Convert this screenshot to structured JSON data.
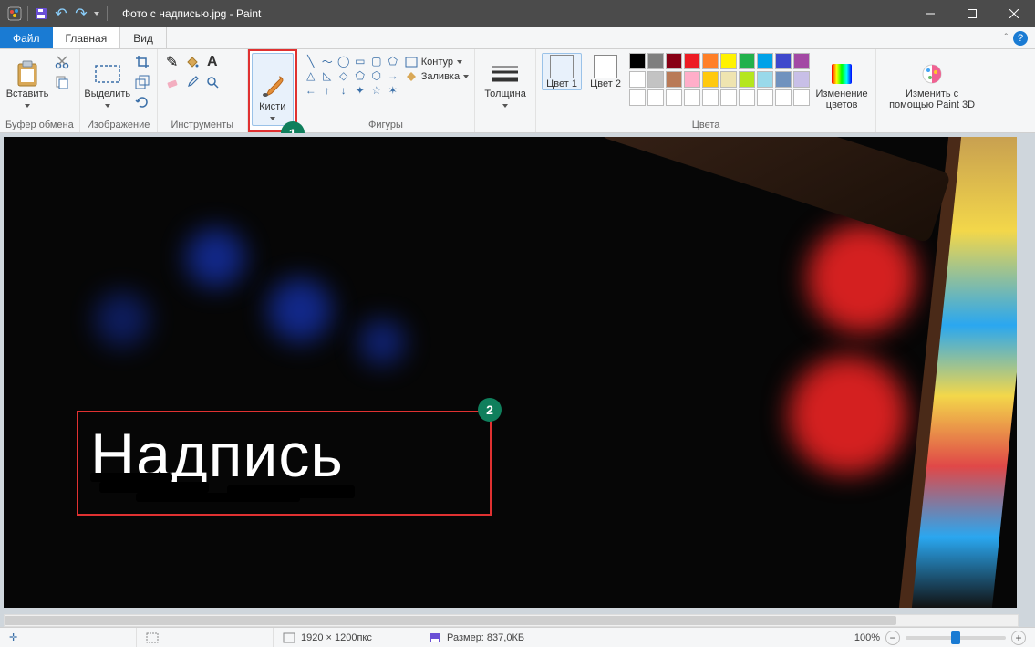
{
  "window": {
    "title": "Фото с надписью.jpg - Paint"
  },
  "tabs": {
    "file": "Файл",
    "home": "Главная",
    "view": "Вид"
  },
  "ribbon": {
    "clipboard": {
      "paste": "Вставить",
      "group": "Буфер обмена"
    },
    "image": {
      "select": "Выделить",
      "group": "Изображение"
    },
    "tools": {
      "group": "Инструменты"
    },
    "brushes": {
      "label": "Кисти"
    },
    "shapes": {
      "outline": "Контур",
      "fill": "Заливка",
      "group": "Фигуры"
    },
    "thickness": {
      "label": "Толщина"
    },
    "colors": {
      "color1": "Цвет 1",
      "color2": "Цвет 2",
      "edit": "Изменение цветов",
      "group": "Цвета",
      "palette": [
        "#000000",
        "#7f7f7f",
        "#880015",
        "#ed1c24",
        "#ff7f27",
        "#fff200",
        "#22b14c",
        "#00a2e8",
        "#3f48cc",
        "#a349a4",
        "#ffffff",
        "#c3c3c3",
        "#b97a57",
        "#ffaec9",
        "#ffc90e",
        "#efe4b0",
        "#b5e61d",
        "#99d9ea",
        "#7092be",
        "#c8bfe7",
        "#ffffff",
        "#ffffff",
        "#ffffff",
        "#ffffff",
        "#ffffff",
        "#ffffff",
        "#ffffff",
        "#ffffff",
        "#ffffff",
        "#ffffff"
      ],
      "c1": "#000000",
      "c2": "#ffffff"
    },
    "paint3d": {
      "label": "Изменить с помощью Paint 3D"
    }
  },
  "annotations": {
    "badge1": "1",
    "badge2": "2"
  },
  "canvas": {
    "text": "Надпись"
  },
  "status": {
    "dimensions": "1920 × 1200пкс",
    "size_label": "Размер: 837,0КБ",
    "zoom": "100%"
  }
}
